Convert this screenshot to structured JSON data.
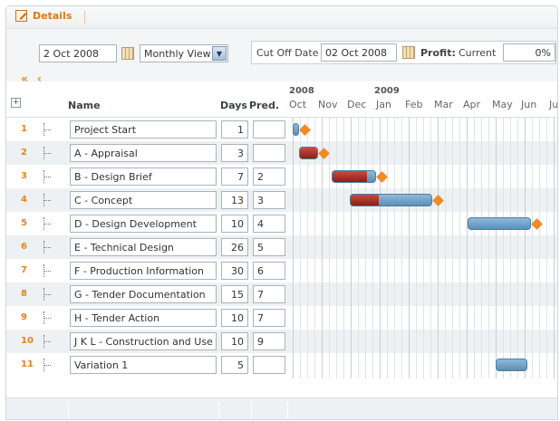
{
  "tab": {
    "label": "Details",
    "icon": "edit-icon"
  },
  "toolbar": {
    "start_date": "2 Oct 2008",
    "view_mode": "Monthly View",
    "cutoff_label": "Cut Off Date",
    "cutoff_date": "02 Oct 2008",
    "profit_label": "Profit:",
    "current_label": "Current",
    "current_value": "0%"
  },
  "nav": {
    "first": "«",
    "prev": "‹"
  },
  "columns": {
    "name": "Name",
    "days": "Days",
    "pred": "Pred."
  },
  "timeline": {
    "years": [
      "2008",
      "2009"
    ],
    "months": [
      "Oct",
      "Nov",
      "Dec",
      "Jan",
      "Feb",
      "Mar",
      "Apr",
      "May",
      "Jun",
      "Ju"
    ]
  },
  "tasks": [
    {
      "num": "1",
      "name": "Project Start",
      "days": "1",
      "pred": "",
      "start": "2008-10-02",
      "complete": 0,
      "milestone": true
    },
    {
      "num": "2",
      "name": "A - Appraisal",
      "days": "3",
      "pred": "",
      "start": "2008-10-09",
      "complete": 100,
      "milestone": true
    },
    {
      "num": "3",
      "name": "B - Design Brief",
      "days": "7",
      "pred": "2",
      "start": "2008-11-12",
      "complete": 80,
      "milestone": true
    },
    {
      "num": "4",
      "name": "C - Concept",
      "days": "13",
      "pred": "3",
      "start": "2008-12-01",
      "complete": 35,
      "milestone": true
    },
    {
      "num": "5",
      "name": "D - Design Development",
      "days": "10",
      "pred": "4",
      "start": "2009-04-04",
      "complete": 0,
      "milestone": true
    },
    {
      "num": "6",
      "name": "E - Technical Design",
      "days": "26",
      "pred": "5"
    },
    {
      "num": "7",
      "name": "F - Production Information",
      "days": "30",
      "pred": "6"
    },
    {
      "num": "8",
      "name": "G - Tender Documentation",
      "days": "15",
      "pred": "7"
    },
    {
      "num": "9",
      "name": "H - Tender Action",
      "days": "10",
      "pred": "7"
    },
    {
      "num": "10",
      "name": "J K L - Construction and Use",
      "days": "10",
      "pred": "9"
    },
    {
      "num": "11",
      "name": "Variation 1",
      "days": "5",
      "pred": "",
      "start": "2009-05-03",
      "complete": 0,
      "milestone": false
    }
  ]
}
